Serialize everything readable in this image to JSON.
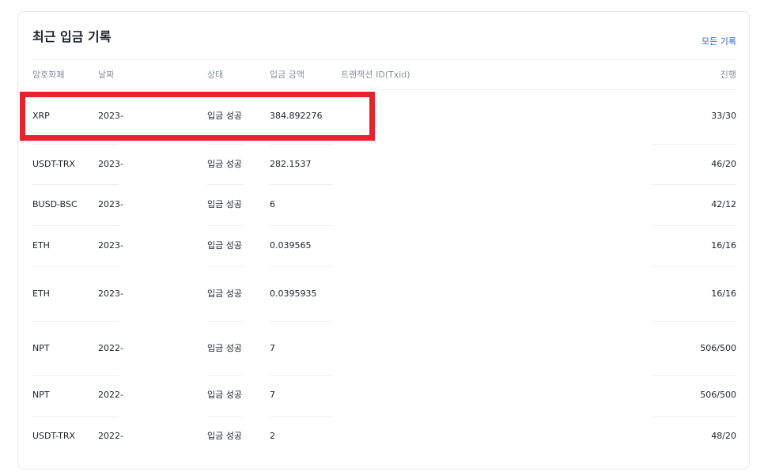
{
  "header": {
    "title": "최근 입금 기록",
    "all_link": "모든 기록"
  },
  "columns": [
    "암호화폐",
    "날짜",
    "상태",
    "입금 금액",
    "트랜잭션 ID(Txid)",
    "진행"
  ],
  "rows": [
    {
      "coin": "XRP",
      "date": "2023-",
      "status": "입금 성공",
      "amount": "384.892276",
      "progress": "33/30"
    },
    {
      "coin": "USDT-TRX",
      "date": "2023-",
      "status": "입금 성공",
      "amount": "282.1537",
      "progress": "46/20"
    },
    {
      "coin": "BUSD-BSC",
      "date": "2023-",
      "status": "입금 성공",
      "amount": "6",
      "progress": "42/12"
    },
    {
      "coin": "ETH",
      "date": "2023-",
      "status": "입금 성공",
      "amount": "0.039565",
      "progress": "16/16"
    },
    {
      "coin": "ETH",
      "date": "2023-",
      "status": "입금 성공",
      "amount": "0.0395935",
      "progress": "16/16"
    },
    {
      "coin": "NPT",
      "date": "2022-",
      "status": "입금 성공",
      "amount": "7",
      "progress": "506/500"
    },
    {
      "coin": "NPT",
      "date": "2022-",
      "status": "입금 성공",
      "amount": "7",
      "progress": "506/500"
    },
    {
      "coin": "USDT-TRX",
      "date": "2022-",
      "status": "입금 성공",
      "amount": "2",
      "progress": "48/20"
    }
  ],
  "highlight_color": "#e8232d"
}
